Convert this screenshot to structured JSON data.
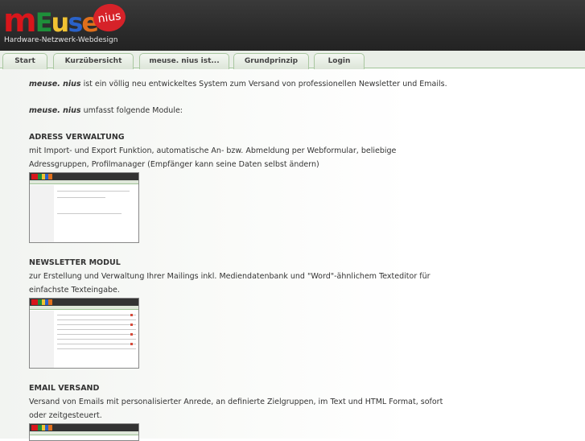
{
  "header": {
    "logo_main": "mEuse",
    "logo_badge": "nius",
    "tagline": "Hardware-Netzwerk-Webdesign"
  },
  "nav": {
    "tabs": [
      {
        "label": "Start"
      },
      {
        "label": "Kurzübersicht"
      },
      {
        "label": "meuse. nius ist..."
      },
      {
        "label": "Grundprinzip"
      },
      {
        "label": "Login"
      }
    ]
  },
  "content": {
    "intro_brand": "meuse. nius",
    "intro_text": " ist ein völlig neu entwickeltes System zum Versand von professionellen Newsletter und Emails.",
    "modules_brand": "meuse. nius",
    "modules_text": " umfasst folgende Module:",
    "sections": [
      {
        "title": "ADRESS VERWALTUNG",
        "text": "mit Import- und Export Funktion, automatische An- bzw. Abmeldung per Webformular, beliebige Adressgruppen, Profilmanager (Empfänger kann seine Daten selbst ändern)"
      },
      {
        "title": "NEWSLETTER MODUL",
        "text": "zur Erstellung und Verwaltung Ihrer Mailings inkl. Mediendatenbank und \"Word\"-ähnlichem Texteditor für einfachste Texteingabe."
      },
      {
        "title": "EMAIL VERSAND",
        "text": "Versand von Emails mit personalisierter Anrede, an definierte Zielgruppen, im Text und HTML Format, sofort oder zeitgesteuert."
      }
    ]
  }
}
